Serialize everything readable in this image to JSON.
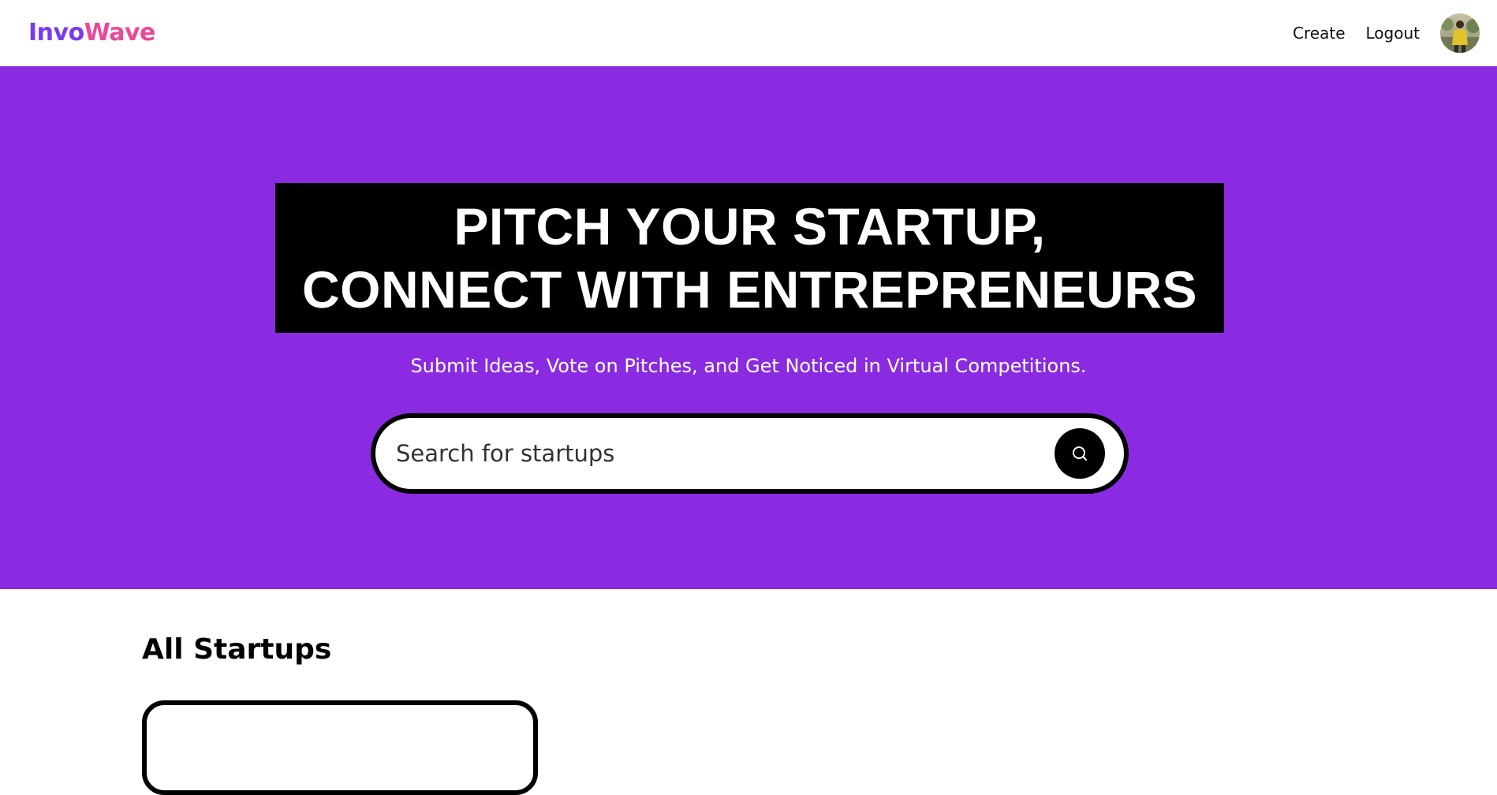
{
  "header": {
    "logo": {
      "part1": "Invo",
      "part2": "Wave"
    },
    "nav": {
      "create_label": "Create",
      "logout_label": "Logout"
    },
    "avatar_icon": "user-avatar"
  },
  "hero": {
    "title_line1": "PITCH YOUR STARTUP,",
    "title_line2": "CONNECT WITH ENTREPRENEURS",
    "subtitle": "Submit Ideas, Vote on Pitches, and Get Noticed in Virtual Competitions.",
    "search": {
      "placeholder": "Search for startups",
      "value": "",
      "button_icon": "search-icon"
    }
  },
  "startups_section": {
    "title": "All Startups"
  },
  "colors": {
    "accent": "#8a2be2",
    "logo_primary": "#7c3aed",
    "logo_secondary": "#ec4899",
    "title_bg": "#000000"
  }
}
